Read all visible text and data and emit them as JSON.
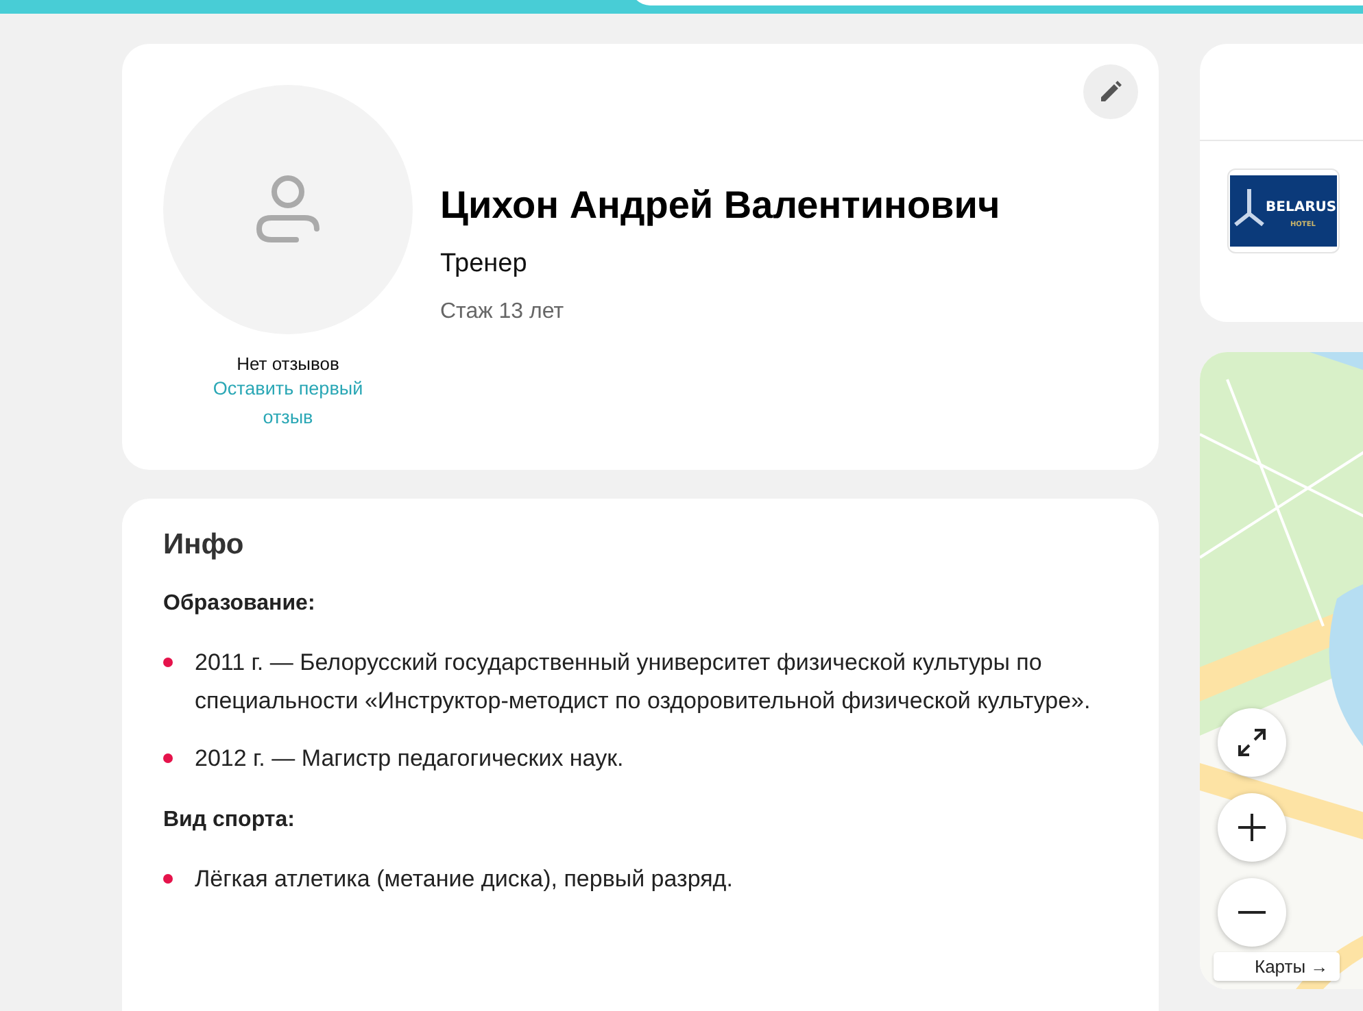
{
  "profile": {
    "name": "Цихон Андрей Валентинович",
    "role": "Тренер",
    "experience": "Стаж 13 лет",
    "reviews_status": "Нет отзывов",
    "review_link": "Оставить первый отзыв"
  },
  "info": {
    "title": "Инфо",
    "sections": [
      {
        "heading": "Образование:",
        "items": [
          "2011 г. — Белорусский государственный университет физической культуры по специальности «Инструктор-методист по оздоровительной физической культуре».",
          "2012 г. — Магистр педагогических наук."
        ]
      },
      {
        "heading": "Вид спорта:",
        "items": [
          "Лёгкая атлетика (метание диска), первый разряд."
        ]
      }
    ]
  },
  "workplace": {
    "logo_text": "BELARUS",
    "logo_subtext": "HOTEL"
  },
  "map": {
    "link": "Карты →"
  }
}
